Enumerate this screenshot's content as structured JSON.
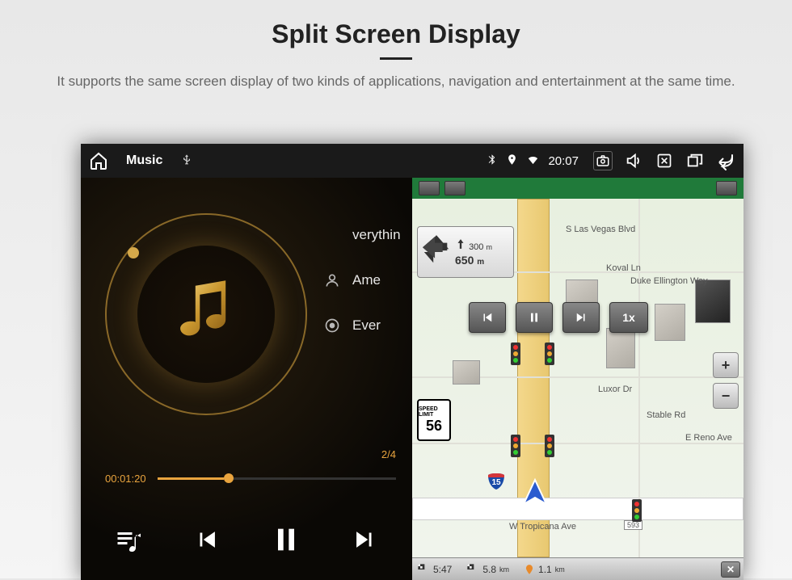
{
  "header": {
    "title": "Split Screen Display",
    "subtitle": "It supports the same screen display of two kinds of applications, navigation and entertainment at the same time."
  },
  "statusbar": {
    "app_title": "Music",
    "source": "⚲",
    "time": "20:07"
  },
  "music": {
    "song": "verythin",
    "artist": "Ame",
    "album": "Ever",
    "elapsed": "00:01:20",
    "track_counter": "2/4"
  },
  "nav": {
    "turn_dist": "300",
    "turn_unit": "m",
    "next_dist": "650",
    "next_unit": "m",
    "speed_limit_label": "SPEED LIMIT",
    "speed_limit": "56",
    "speed_btn": "1x",
    "streets": {
      "s_las_vegas": "S Las Vegas Blvd",
      "koval": "Koval Ln",
      "duke": "Duke Ellington Way",
      "luxor": "Luxor Dr",
      "stable": "Stable Rd",
      "reno": "E Reno Ave",
      "tropicana": "W Tropicana Ave",
      "tropicana_num": "593",
      "highway1": "15"
    },
    "bottom": {
      "eta": "5:47",
      "dist1": "5.8",
      "dist1_unit": "km",
      "dist2": "1.1",
      "dist2_unit": "km"
    }
  }
}
